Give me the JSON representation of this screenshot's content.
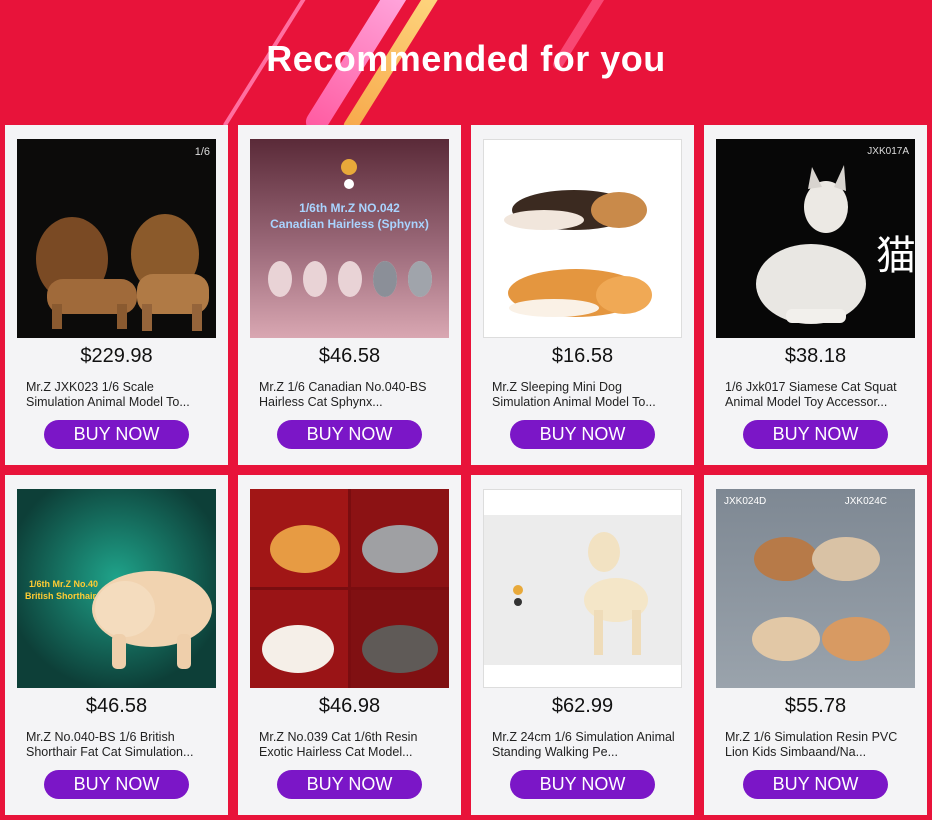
{
  "header": {
    "title": "Recommended for you"
  },
  "colors": {
    "background": "#e8133a",
    "button": "#7b16c7",
    "card": "#f4f4f6"
  },
  "products": [
    {
      "price": "$229.98",
      "name": "Mr.Z JXK023 1/6 Scale Simulation Animal Model To...",
      "button": "BUY NOW",
      "image": "lion-figures",
      "tag": "1/6"
    },
    {
      "price": "$46.58",
      "name": "Mr.Z 1/6 Canadian No.040-BS Hairless Cat Sphynx...",
      "button": "BUY NOW",
      "image": "sphynx-cats",
      "tag": "1/6th Mr.Z NO.042",
      "tag2": "Canadian Hairless (Sphynx)"
    },
    {
      "price": "$16.58",
      "name": "Mr.Z Sleeping Mini Dog Simulation Animal Model To...",
      "button": "BUY NOW",
      "image": "sleeping-corgis"
    },
    {
      "price": "$38.18",
      "name": "1/6 Jxk017 Siamese Cat Squat Animal Model Toy Accessor...",
      "button": "BUY NOW",
      "image": "siamese-cat",
      "tag": "JXK017A"
    },
    {
      "price": "$46.58",
      "name": "Mr.Z No.040-BS 1/6 British Shorthair Fat Cat Simulation...",
      "button": "BUY NOW",
      "image": "british-shorthair",
      "tag": "1/6th Mr.Z No.40",
      "tag2": "British Shorthair"
    },
    {
      "price": "$46.98",
      "name": "Mr.Z No.039 Cat 1/6th Resin Exotic Hairless Cat Model...",
      "button": "BUY NOW",
      "image": "exotic-cats"
    },
    {
      "price": "$62.99",
      "name": "Mr.Z 24cm 1/6 Simulation Animal Standing Walking Pe...",
      "button": "BUY NOW",
      "image": "labrador"
    },
    {
      "price": "$55.78",
      "name": "Mr.Z 1/6 Simulation Resin PVC Lion Kids Simbaand/Na...",
      "button": "BUY NOW",
      "image": "lion-cubs",
      "tag": "JXK024D",
      "tag2": "JXK024C"
    }
  ]
}
